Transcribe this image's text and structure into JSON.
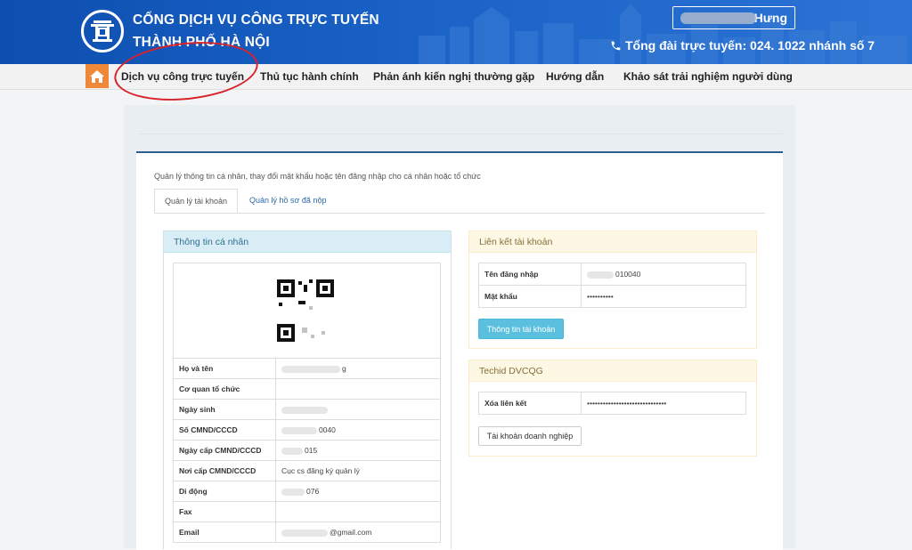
{
  "header": {
    "title": "CỔNG DỊCH VỤ CÔNG TRỰC TUYẾN",
    "subtitle": "THÀNH PHỐ HÀ NỘI",
    "user_name": "Hưng",
    "hotline": "Tổng đài trực tuyến: 024. 1022 nhánh số 7",
    "logo_icon": "hanoi-khue-van-cac-logo",
    "phone_icon": "phone-icon",
    "colors": {
      "header_bg": "#1a5fc4",
      "home_bg": "#f0883a",
      "circle": "#d8232a"
    }
  },
  "nav": {
    "home_icon": "home-icon",
    "items": [
      "Dịch vụ công trực tuyến",
      "Thủ tục hành chính",
      "Phản ánh kiến nghị thường gặp",
      "Hướng dẫn",
      "Khảo sát trải nghiệm người dùng"
    ]
  },
  "page": {
    "description": "Quản lý thông tin cá nhân, thay đổi mật khẩu hoặc tên đăng nhập cho cá nhân hoặc tổ chức",
    "tabs": [
      "Quản lý tài khoản",
      "Quản lý hồ sơ đã nộp"
    ]
  },
  "personal": {
    "heading": "Thông tin cá nhân",
    "rows": [
      {
        "label": "Họ và tên",
        "value": "g"
      },
      {
        "label": "Cơ quan tổ chức",
        "value": ""
      },
      {
        "label": "Ngày sinh",
        "value": ""
      },
      {
        "label": "Số CMND/CCCD",
        "value": "0040"
      },
      {
        "label": "Ngày cấp CMND/CCCD",
        "value": "015"
      },
      {
        "label": "Nơi cấp CMND/CCCD",
        "value": "Cục cs đăng ký quản lý"
      },
      {
        "label": "Di động",
        "value": "076"
      },
      {
        "label": "Fax",
        "value": ""
      },
      {
        "label": "Email",
        "value": "@gmail.com"
      }
    ]
  },
  "account_link": {
    "heading": "Liên kết tài khoản",
    "rows": [
      {
        "label": "Tên đăng nhập",
        "value": "010040"
      },
      {
        "label": "Mật khẩu",
        "value": "••••••••••"
      }
    ],
    "button": "Thông tin tài khoản"
  },
  "techid": {
    "heading": "Techid DVCQG",
    "rows": [
      {
        "label": "Xóa liên kết",
        "value": "••••••••••••••••••••••••••••••"
      }
    ],
    "button": "Tài khoản doanh nghiệp"
  }
}
